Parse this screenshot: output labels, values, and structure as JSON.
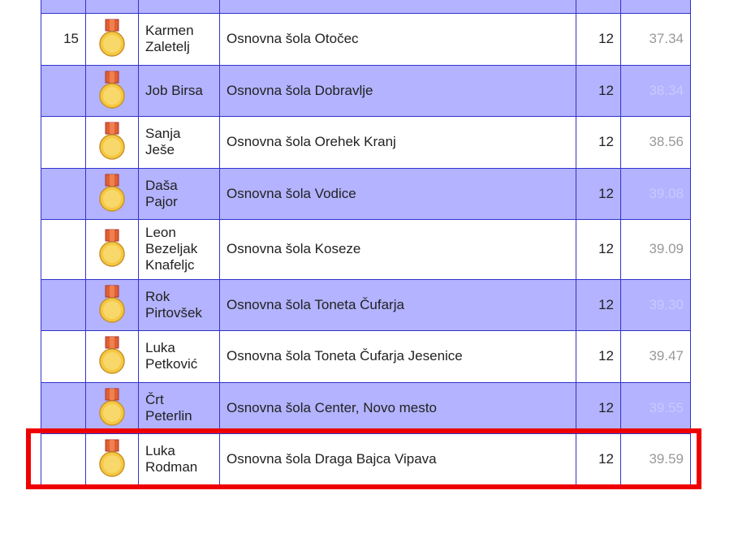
{
  "rows": [
    {
      "rank": "15",
      "name": "Karmen Zaletelj",
      "school": "Osnovna šola Otočec",
      "points": "12",
      "time": "37.34"
    },
    {
      "rank": "",
      "name": "Job Birsa",
      "school": "Osnovna šola Dobravlje",
      "points": "12",
      "time": "38.34"
    },
    {
      "rank": "",
      "name": "Sanja Ješe",
      "school": "Osnovna šola Orehek Kranj",
      "points": "12",
      "time": "38.56"
    },
    {
      "rank": "",
      "name": "Daša Pajor",
      "school": "Osnovna šola Vodice",
      "points": "12",
      "time": "39.08"
    },
    {
      "rank": "",
      "name": "Leon Bezeljak Knafeljc",
      "school": "Osnovna šola Koseze",
      "points": "12",
      "time": "39.09"
    },
    {
      "rank": "",
      "name": "Rok Pirtovšek",
      "school": "Osnovna šola Toneta Čufarja",
      "points": "12",
      "time": "39.30"
    },
    {
      "rank": "",
      "name": "Luka Petković",
      "school": "Osnovna šola Toneta Čufarja Jesenice",
      "points": "12",
      "time": "39.47"
    },
    {
      "rank": "",
      "name": "Črt Peterlin",
      "school": "Osnovna šola Center, Novo mesto",
      "points": "12",
      "time": "39.55"
    },
    {
      "rank": "",
      "name": "Luka Rodman",
      "school": "Osnovna šola Draga Bajca Vipava",
      "points": "12",
      "time": "39.59"
    }
  ],
  "medal_icon": "bronze-medal-icon",
  "colors": {
    "row_alt": "#b3b3ff",
    "border": "#3333cc",
    "highlight": "#ee0000",
    "medal_ribbon": "#e06030",
    "medal_disc": "#f5c842"
  }
}
